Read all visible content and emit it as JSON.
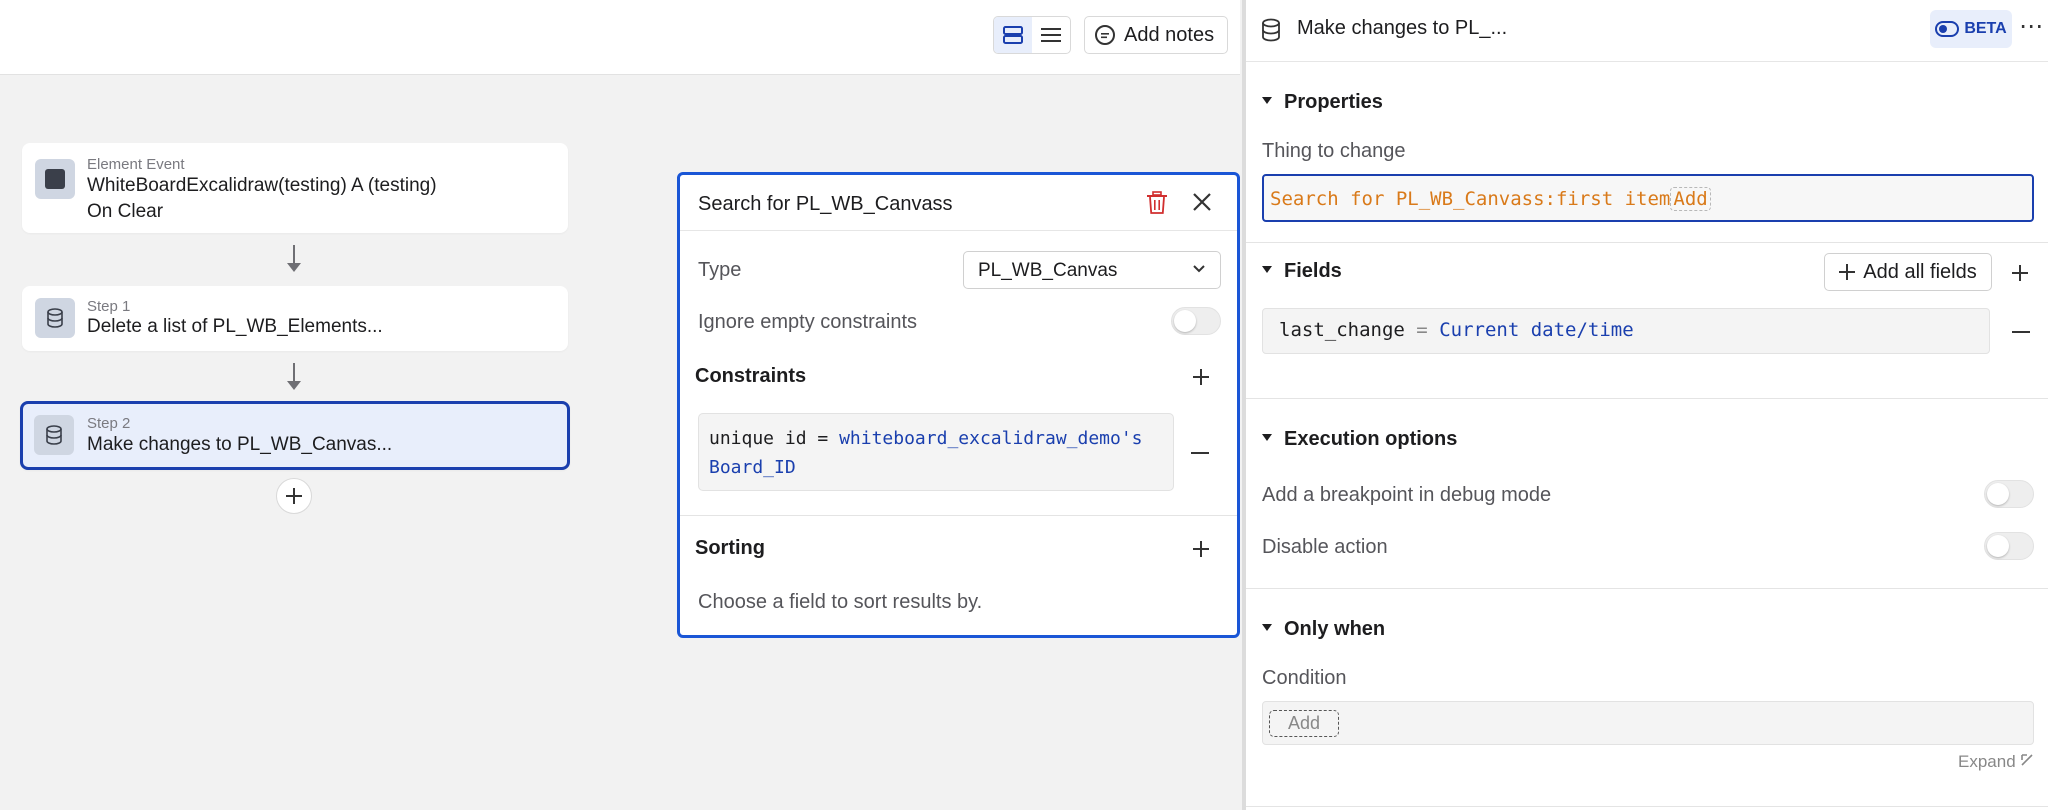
{
  "toolbar": {
    "add_notes_label": "Add notes"
  },
  "workflow": {
    "event": {
      "subtitle": "Element Event",
      "line1": "WhiteBoardExcalidraw(testing) A (testing)",
      "line2": "On Clear"
    },
    "steps": [
      {
        "subtitle": "Step 1",
        "label": "Delete a list of PL_WB_Elements..."
      },
      {
        "subtitle": "Step 2",
        "label": "Make changes to PL_WB_Canvas..."
      }
    ]
  },
  "search_popup": {
    "title": "Search for PL_WB_Canvass",
    "type_label": "Type",
    "type_value": "PL_WB_Canvas",
    "ignore_label": "Ignore empty constraints",
    "constraints_title": "Constraints",
    "constraint": {
      "field": "unique id",
      "op": "=",
      "value_line1": "whiteboard_excalidraw_demo's",
      "value_line2": "Board_ID"
    },
    "sorting_title": "Sorting",
    "sorting_hint": "Choose a field to sort results by."
  },
  "panel": {
    "title": "Make changes to PL_...",
    "beta_label": "BETA",
    "more_label": "⋯",
    "properties_title": "Properties",
    "thing_label": "Thing to change",
    "thing_value": "Search for PL_WB_Canvass:first item",
    "thing_add": "Add",
    "fields_title": "Fields",
    "add_all_label": "Add all fields",
    "field_row": {
      "name": "last_change",
      "op": "=",
      "value": "Current date/time"
    },
    "execution_title": "Execution options",
    "breakpoint_label": "Add a breakpoint in debug mode",
    "disable_label": "Disable action",
    "only_when_title": "Only when",
    "condition_label": "Condition",
    "condition_add": "Add",
    "expand_label": "Expand"
  },
  "colors": {
    "accent": "#1a3fae",
    "popup_border": "#1a56d6",
    "expression_blue": "#1a3fae",
    "expression_orange": "#d97a1a",
    "delete_red": "#d12f2f"
  },
  "icons": [
    "database-icon",
    "trash-icon",
    "close-icon",
    "chevron-down-icon",
    "plus-icon",
    "minus-icon",
    "note-icon",
    "toggle-icon",
    "expand-icon"
  ]
}
